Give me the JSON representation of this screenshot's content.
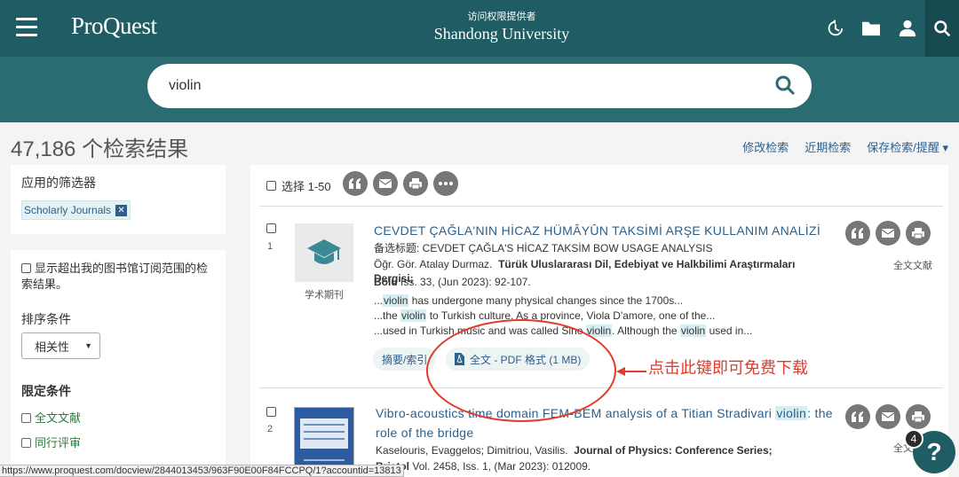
{
  "header": {
    "logo": "ProQuest",
    "access_small": "访问权限提供者",
    "access_institution": "Shandong University"
  },
  "search": {
    "value": "violin",
    "placeholder": ""
  },
  "results": {
    "count_text": "47,186 个检索结果",
    "links": [
      "修改检索",
      "近期检索",
      "保存检索/提醒 ▾"
    ]
  },
  "sidebar": {
    "applied_title": "应用的筛选器",
    "applied_chip": "Scholarly Journals",
    "applied_chip_remove": "✕",
    "show_beyond": "显示超出我的图书馆订阅范围的检索结果。",
    "sort_label": "排序条件",
    "sort_value": "相关性",
    "limit_label": "限定条件",
    "limits": [
      "全文文献",
      "同行评审"
    ]
  },
  "main": {
    "select_label": "选择 1-50",
    "records": [
      {
        "num": "1",
        "type_label": "学术期刊",
        "title": "CEVDET ÇAĞLA'NIN HİCAZ HÜMÂYÛN TAKSİMİ ARŞE KULLANIM ANALİZİ",
        "alt_title": "备选标题: CEVDET ÇAĞLA'S HİCAZ TAKSİM BOW USAGE ANALYSIS",
        "authors": "Öğr. Gör. Atalay Durmaz.",
        "journal": "Türük Uluslararası Dil, Edebiyat ve Halkbilimi Araştırmaları Dergisi;",
        "issue_bold": "Bolu",
        "issue_rest": " Iss. 33,  (Jun 2023): 92-107.",
        "snip1_a": "...",
        "snip1_hl": "violin",
        "snip1_b": " has undergone many physical changes since the 1700s...",
        "snip2_a": "...the ",
        "snip2_hl": "violin",
        "snip2_b": " to Turkish culture. As a province, Viola D'amore, one of the...",
        "snip3_a": "...used in Turkish music and was called Sine ",
        "snip3_hl": "violin",
        "snip3_b": ". Although the ",
        "snip3_hl2": "violin",
        "snip3_c": " used in...",
        "abstract_btn": "摘要/索引",
        "pdf_btn": "全文 - PDF 格式 (1 MB)",
        "fulltext_label": "全文文献"
      },
      {
        "num": "2",
        "title_a": "Vibro-acoustics time domain FEM-BEM analysis of a Titian Stradivari ",
        "title_hl": "violin",
        "title_b": ": the role of the bridge",
        "authors": "Kaselouris, Evaggelos; Dimitriou, Vasilis.",
        "journal": "Journal of Physics: Conference Series;",
        "issue_bold": "Bristol",
        "issue_rest": " Vol. 2458, Iss. 1,  (Mar 2023): 012009.",
        "fulltext_label": "全文"
      }
    ]
  },
  "annotation": {
    "text": "点击此键即可免费下载"
  },
  "status_url": "https://www.proquest.com/docview/2844013453/963F90E00F84FCCPQ/1?accountid=13813",
  "help": {
    "label": "?",
    "badge": "4"
  },
  "colors": {
    "header": "#2b6b72",
    "topbar": "#1f5c63",
    "link": "#2c5f8a",
    "annotation": "#e23b2a"
  }
}
